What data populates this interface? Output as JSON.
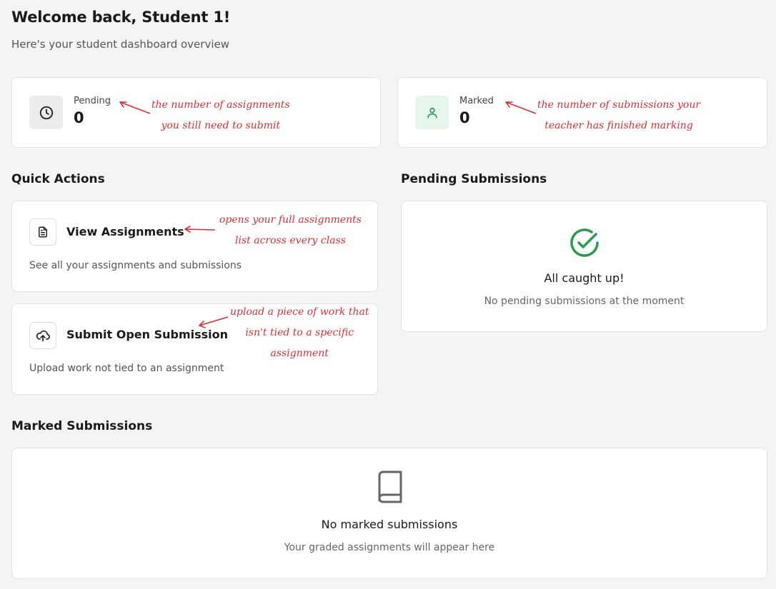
{
  "header": {
    "title": "Welcome back, Student 1!",
    "subtitle": "Here's your student dashboard overview"
  },
  "stats": [
    {
      "label": "Pending",
      "value": "0",
      "icon": "clock-icon",
      "note_line1": "the number of assignments",
      "note_line2": "you still need to submit"
    },
    {
      "label": "Marked",
      "value": "0",
      "icon": "user-icon",
      "note_line1": "the number of submissions your",
      "note_line2": "teacher has finished marking"
    }
  ],
  "quick_actions": {
    "title": "Quick Actions",
    "items": [
      {
        "title": "View Assignments",
        "description": "See all your assignments and submissions",
        "icon": "file-text-icon",
        "note_line1": "opens your full assignments",
        "note_line2": "list across every class"
      },
      {
        "title": "Submit Open Submission",
        "description": "Upload work not tied to an assignment",
        "icon": "upload-cloud-icon",
        "note_line1": "upload a piece of work that",
        "note_line2": "isn't tied to a specific",
        "note_line3": "assignment"
      }
    ]
  },
  "pending_submissions": {
    "title": "Pending Submissions",
    "empty_title": "All caught up!",
    "empty_description": "No pending submissions at the moment",
    "icon": "check-circle-icon"
  },
  "marked_submissions": {
    "title": "Marked Submissions",
    "empty_title": "No marked submissions",
    "empty_description": "Your graded assignments will appear here",
    "icon": "book-icon"
  },
  "colors": {
    "annotation": "#d6303a",
    "success": "#2e9a4f",
    "success_bg": "#e8f5ec",
    "neutral_bg": "#ececec"
  }
}
